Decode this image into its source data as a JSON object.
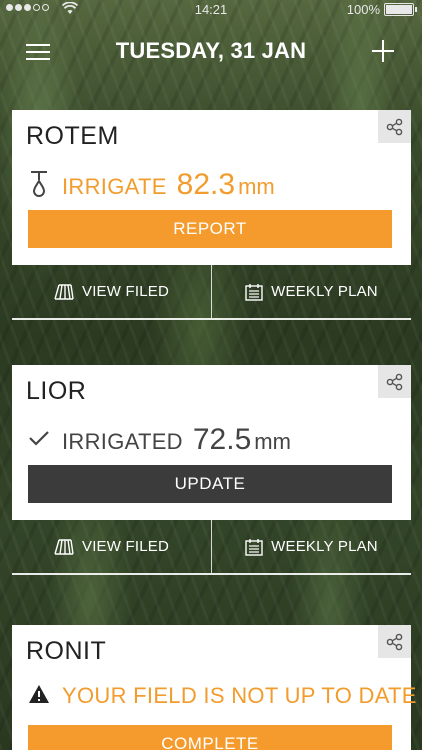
{
  "status_bar": {
    "time": "14:21",
    "battery": "100%"
  },
  "header": {
    "title": "TUESDAY, 31 JAN"
  },
  "fields": [
    {
      "name": "ROTEM",
      "status_icon": "drip-icon",
      "status_label": "IRRIGATE",
      "value": "82.3",
      "unit": "mm",
      "action": "REPORT",
      "view_label": "VIEW FILED",
      "plan_label": "WEEKLY PLAN"
    },
    {
      "name": "LIOR",
      "status_icon": "check-icon",
      "status_label": "IRRIGATED",
      "value": "72.5",
      "unit": "mm",
      "action": "UPDATE",
      "view_label": "VIEW FILED",
      "plan_label": "WEEKLY PLAN"
    },
    {
      "name": "RONIT",
      "status_icon": "warning-icon",
      "status_label": "YOUR FIELD IS NOT UP TO DATE",
      "action": "COMPLETE"
    }
  ],
  "colors": {
    "accent": "#f59a2c",
    "dark_button": "#3b3b3b"
  }
}
